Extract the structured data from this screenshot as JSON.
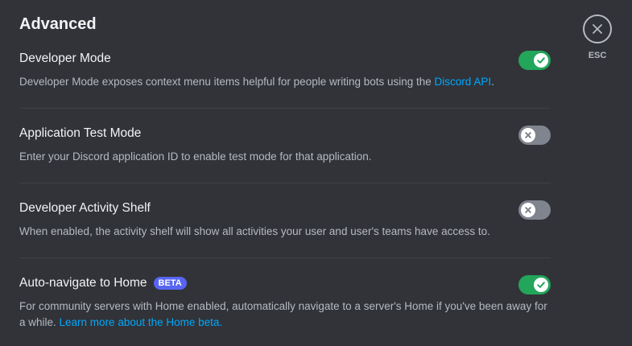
{
  "section": {
    "title": "Advanced"
  },
  "esc": {
    "label": "ESC"
  },
  "settings": [
    {
      "title": "Developer Mode",
      "description": "Developer Mode exposes context menu items helpful for people writing bots using the ",
      "link": "Discord API",
      "suffix": ".",
      "enabled": true
    },
    {
      "title": "Application Test Mode",
      "description": "Enter your Discord application ID to enable test mode for that application.",
      "enabled": false
    },
    {
      "title": "Developer Activity Shelf",
      "description": "When enabled, the activity shelf will show all activities your user and user's teams have access to.",
      "enabled": false
    },
    {
      "title": "Auto-navigate to Home",
      "badge": "BETA",
      "description": "For community servers with Home enabled, automatically navigate to a server's Home if you've been away for a while. ",
      "link": "Learn more about the Home beta.",
      "enabled": true
    }
  ],
  "colors": {
    "toggle_on": "#23a55a",
    "toggle_off": "#80848e",
    "link": "#00a8fc",
    "badge": "#5865f2"
  },
  "icons": {
    "toggle_on": "check-icon",
    "toggle_off": "x-icon",
    "close": "close-icon"
  }
}
